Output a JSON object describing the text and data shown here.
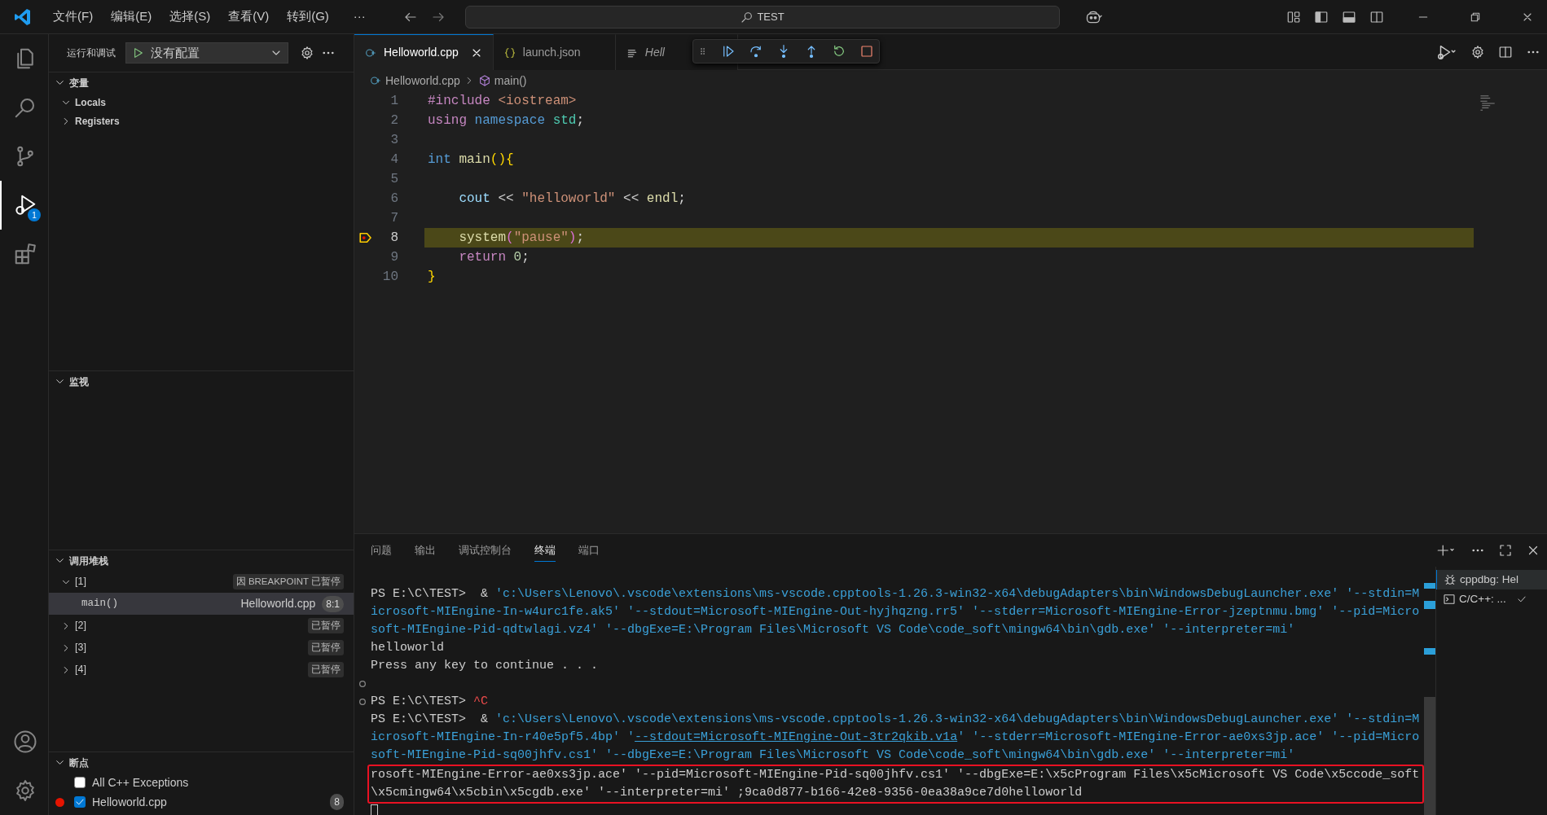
{
  "title_bar": {
    "menus": [
      "文件(F)",
      "编辑(E)",
      "选择(S)",
      "查看(V)",
      "转到(G)"
    ],
    "overflow": "···",
    "command_center": "TEST"
  },
  "activity_bar": {
    "items": [
      {
        "kind": "explorer",
        "selected": false
      },
      {
        "kind": "search",
        "selected": false
      },
      {
        "kind": "source_control",
        "selected": false
      },
      {
        "kind": "run_debug",
        "selected": true,
        "badge": "1"
      },
      {
        "kind": "extensions",
        "selected": false
      }
    ]
  },
  "sidebar": {
    "title": "运行和调试",
    "configuration": "没有配置",
    "variables": {
      "title": "变量",
      "expanded": true,
      "items": [
        {
          "label": "Locals",
          "expanded": true
        },
        {
          "label": "Registers",
          "expanded": false
        }
      ]
    },
    "watch": {
      "title": "监视",
      "expanded": true
    },
    "call_stack": {
      "title": "调用堆栈",
      "expanded": true,
      "threads": [
        {
          "label": "[1]",
          "expanded": true,
          "status": "因 BREAKPOINT 已暂停",
          "frames": [
            {
              "name": "main()",
              "file": "Helloworld.cpp",
              "position": "8:1",
              "selected": true
            }
          ]
        },
        {
          "label": "[2]",
          "expanded": false,
          "status": "已暂停"
        },
        {
          "label": "[3]",
          "expanded": false,
          "status": "已暂停"
        },
        {
          "label": "[4]",
          "expanded": false,
          "status": "已暂停"
        }
      ]
    },
    "breakpoints": {
      "title": "断点",
      "expanded": true,
      "items": [
        {
          "label": "All C++ Exceptions",
          "kind": "exception",
          "checked": false
        },
        {
          "label": "Helloworld.cpp",
          "kind": "file",
          "checked": true,
          "line": "8"
        }
      ]
    }
  },
  "editor": {
    "tabs": [
      {
        "label": "Helloworld.cpp",
        "kind": "cpp",
        "selected": true,
        "preview": false
      },
      {
        "label": "launch.json",
        "kind": "json",
        "selected": false,
        "preview": false
      },
      {
        "label": "Hell",
        "kind": "text",
        "selected": false,
        "preview": true
      }
    ],
    "breadcrumb": [
      {
        "label": "Helloworld.cpp",
        "kind": "cpp"
      },
      {
        "label": "main()",
        "kind": "symbol"
      }
    ],
    "lines": [
      {
        "number": "1",
        "current": false,
        "tokens": [
          {
            "t": "#include",
            "color": "#c586c0"
          },
          {
            "t": " <iostream>",
            "color": "#ce9178"
          }
        ]
      },
      {
        "number": "2",
        "current": false,
        "tokens": [
          {
            "t": "using",
            "color": "#c586c0"
          },
          {
            "t": " namespace",
            "color": "#569cd6"
          },
          {
            "t": " std",
            "color": "#4ec9b0"
          },
          {
            "t": ";",
            "color": "#d4d4d4"
          }
        ]
      },
      {
        "number": "3",
        "current": false
      },
      {
        "number": "4",
        "current": false,
        "tokens": [
          {
            "t": "int",
            "color": "#569cd6"
          },
          {
            "t": " main",
            "color": "#dcdcaa"
          },
          {
            "t": "(){",
            "color": "#ffd700"
          }
        ]
      },
      {
        "number": "5",
        "current": false
      },
      {
        "number": "6",
        "current": false,
        "tokens": [
          {
            "t": "    cout",
            "color": "#9cdcfe"
          },
          {
            "t": " <<",
            "color": "#d4d4d4"
          },
          {
            "t": " \"helloworld\"",
            "color": "#ce9178"
          },
          {
            "t": " <<",
            "color": "#d4d4d4"
          },
          {
            "t": " endl",
            "color": "#dcdcaa"
          },
          {
            "t": ";",
            "color": "#d4d4d4"
          }
        ]
      },
      {
        "number": "7",
        "current": false
      },
      {
        "number": "8",
        "current": true,
        "tokens": [
          {
            "t": "    system",
            "color": "#dcdcaa"
          },
          {
            "t": "(",
            "color": "#da70d6"
          },
          {
            "t": "\"pause\"",
            "color": "#ce9178"
          },
          {
            "t": ")",
            "color": "#da70d6"
          },
          {
            "t": ";",
            "color": "#d4d4d4"
          }
        ]
      },
      {
        "number": "9",
        "current": false,
        "tokens": [
          {
            "t": "    return",
            "color": "#c586c0"
          },
          {
            "t": " 0",
            "color": "#b5cea8"
          },
          {
            "t": ";",
            "color": "#d4d4d4"
          }
        ]
      },
      {
        "number": "10",
        "current": false,
        "tokens": [
          {
            "t": "}",
            "color": "#ffd700"
          }
        ]
      }
    ]
  },
  "panel": {
    "tabs": [
      {
        "label": "问题",
        "selected": false
      },
      {
        "label": "输出",
        "selected": false
      },
      {
        "label": "调试控制台",
        "selected": false
      },
      {
        "label": "终端",
        "selected": true
      },
      {
        "label": "端口",
        "selected": false
      }
    ],
    "terminal": {
      "cursor": true,
      "lines": [
        {
          "decoration": false,
          "boxed": false,
          "segments": [
            {
              "t": "PS E:\\C\\TEST>  & ",
              "color": "#cccccc",
              "underlined": false
            },
            {
              "t": "'c:\\Users\\Lenovo\\.vscode\\extensions\\ms-vscode.cpptools-1.26.3-win32-x64\\debugAdapters\\bin\\WindowsDebugLauncher.exe' '--stdin=M",
              "color": "#3aa0d8",
              "underlined": false
            }
          ]
        },
        {
          "decoration": false,
          "boxed": false,
          "segments": [
            {
              "t": "icrosoft-MIEngine-In-w4urc1fe.ak5' '--stdout=Microsoft-MIEngine-Out-hyjhqzng.rr5' '--stderr=Microsoft-MIEngine-Error-jzeptnmu.bmg' '--pid=Micro",
              "color": "#3aa0d8",
              "underlined": false
            }
          ]
        },
        {
          "decoration": false,
          "boxed": false,
          "segments": [
            {
              "t": "soft-MIEngine-Pid-qdtwlagi.vz4' '--dbgExe=E:\\Program Files\\Microsoft VS Code\\code_soft\\mingw64\\bin\\gdb.exe' '--interpreter=mi'",
              "color": "#3aa0d8",
              "underlined": false
            }
          ]
        },
        {
          "decoration": false,
          "boxed": false,
          "segments": [
            {
              "t": "helloworld",
              "color": "#cccccc",
              "underlined": false
            }
          ]
        },
        {
          "decoration": false,
          "boxed": false,
          "segments": [
            {
              "t": "Press any key to continue . . .",
              "color": "#cccccc",
              "underlined": false
            }
          ]
        },
        {
          "decoration": true,
          "boxed": false
        },
        {
          "decoration": true,
          "boxed": false,
          "segments": [
            {
              "t": "PS E:\\C\\TEST> ",
              "color": "#cccccc",
              "underlined": false
            },
            {
              "t": "^C",
              "color": "#f14c4c",
              "underlined": false
            }
          ]
        },
        {
          "decoration": false,
          "boxed": false,
          "segments": [
            {
              "t": "PS E:\\C\\TEST>  & ",
              "color": "#cccccc",
              "underlined": false
            },
            {
              "t": "'c:\\Users\\Lenovo\\.vscode\\extensions\\ms-vscode.cpptools-1.26.3-win32-x64\\debugAdapters\\bin\\WindowsDebugLauncher.exe' '--stdin=M",
              "color": "#3aa0d8",
              "underlined": false
            }
          ]
        },
        {
          "decoration": false,
          "boxed": false,
          "segments": [
            {
              "t": "icrosoft-MIEngine-In-r40e5pf5.4bp' '",
              "color": "#3aa0d8",
              "underlined": false
            },
            {
              "t": "--stdout=Microsoft-MIEngine-Out-3tr2qkib.v1a",
              "color": "#3aa0d8",
              "underlined": true
            },
            {
              "t": "' '--stderr=Microsoft-MIEngine-Error-ae0xs3jp.ace' '--pid=Micro",
              "color": "#3aa0d8",
              "underlined": false
            }
          ]
        },
        {
          "decoration": false,
          "boxed": false,
          "segments": [
            {
              "t": "soft-MIEngine-Pid-sq00jhfv.cs1' '--dbgExe=E:\\Program Files\\Microsoft VS Code\\code_soft\\mingw64\\bin\\gdb.exe' '--interpreter=mi'",
              "color": "#3aa0d8",
              "underlined": false
            }
          ]
        },
        {
          "decoration": false,
          "boxed": true,
          "segments": [
            {
              "t": "rosoft-MIEngine-Error-ae0xs3jp.ace' '--pid=Microsoft-MIEngine-Pid-sq00jhfv.cs1' '--dbgExe=E:\\x5cProgram Files\\x5cMicrosoft VS Code\\x5ccode_soft",
              "color": "#cccccc",
              "underlined": false
            }
          ]
        },
        {
          "decoration": false,
          "boxed": true,
          "segments": [
            {
              "t": "\\x5cmingw64\\x5cbin\\x5cgdb.exe' '--interpreter=mi' ;9ca0d877-b166-42e8-9356-0ea38a9ce7d0helloworld",
              "color": "#cccccc",
              "underlined": false
            }
          ]
        }
      ]
    },
    "terminals": [
      {
        "label": "cppdbg: Hel",
        "kind": "debug",
        "selected": true
      },
      {
        "label": "C/C++: ...",
        "kind": "task",
        "selected": false
      }
    ]
  }
}
